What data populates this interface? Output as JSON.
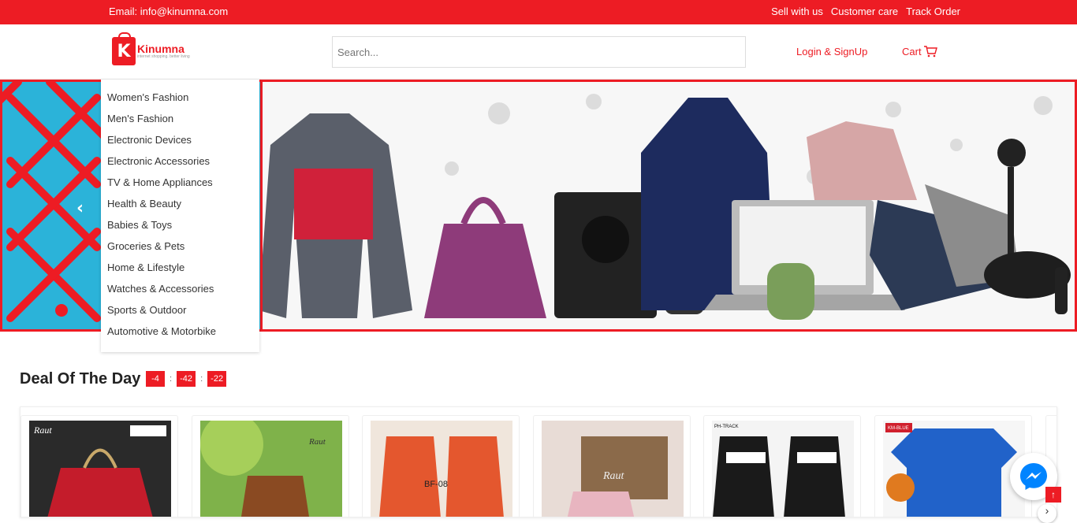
{
  "topbar": {
    "email": "Email: info@kinumna.com",
    "links": [
      "Sell with us",
      "Customer care",
      "Track Order"
    ]
  },
  "header": {
    "logo_letter": "K",
    "logo_brand": "Kinumna",
    "logo_tagline": "internet shopping. better living",
    "search_placeholder": "Search...",
    "login_label": "Login & SignUp",
    "cart_label": "Cart"
  },
  "categories": [
    "Women's Fashion",
    "Men's Fashion",
    "Electronic Devices",
    "Electronic Accessories",
    "TV & Home Appliances",
    "Health & Beauty",
    "Babies & Toys",
    "Groceries & Pets",
    "Home & Lifestyle",
    "Watches & Accessories",
    "Sports & Outdoor",
    "Automotive & Motorbike"
  ],
  "deal": {
    "title": "Deal Of The Day",
    "timer": [
      "-4",
      "-42",
      "-22"
    ],
    "separator": ":"
  },
  "products": [
    {
      "caption": "Raut"
    },
    {
      "caption": "Raut"
    },
    {
      "caption": "BF-08"
    },
    {
      "caption": "Raut"
    },
    {
      "caption": "PH-TRACK"
    },
    {
      "caption": "KM-BLUE"
    }
  ],
  "colors": {
    "accent": "#ed1c24",
    "banner_blue": "#2bb3d9",
    "messenger": "#0084ff"
  }
}
